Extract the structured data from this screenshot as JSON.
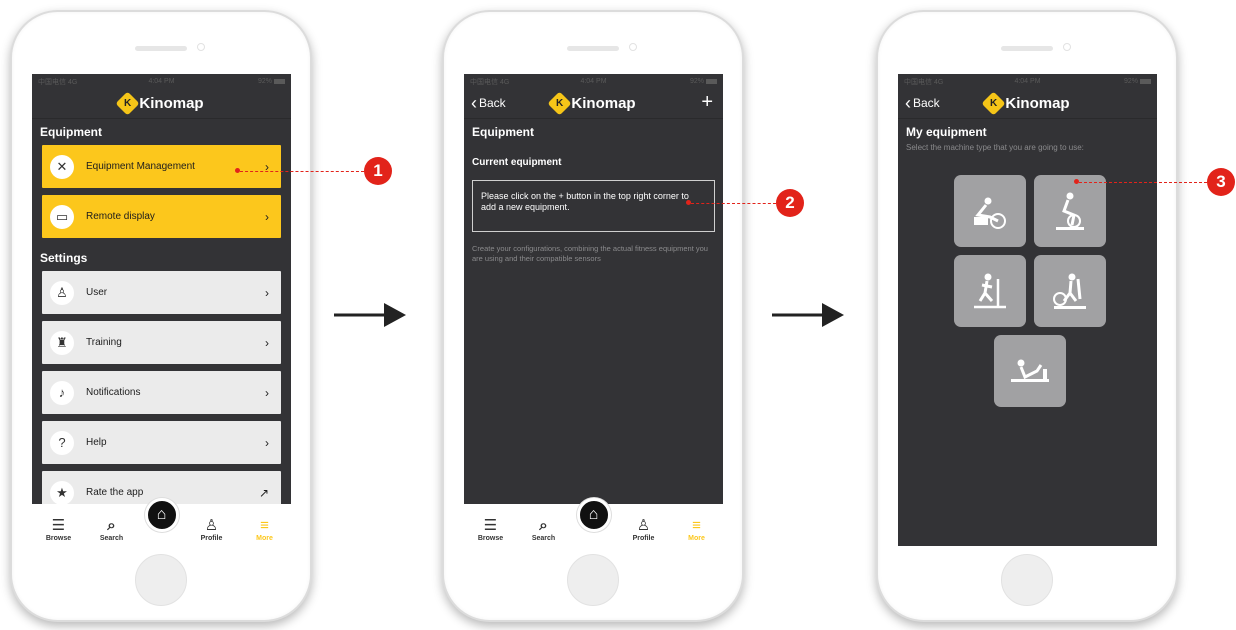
{
  "brand": "Kinomap",
  "status": {
    "carrier": "中国电信 4G",
    "time": "4:04 PM",
    "battery": "92%"
  },
  "screen1": {
    "section_equipment": "Equipment",
    "equipment_items": [
      {
        "label": "Equipment Management",
        "icon": "tools-icon"
      },
      {
        "label": "Remote display",
        "icon": "monitor-icon"
      }
    ],
    "section_settings": "Settings",
    "settings_items": [
      {
        "label": "User",
        "icon": "user-icon"
      },
      {
        "label": "Training",
        "icon": "trophy-icon"
      },
      {
        "label": "Notifications",
        "icon": "bell-icon"
      },
      {
        "label": "Help",
        "icon": "help-icon"
      },
      {
        "label": "Rate the app",
        "icon": "star-hand-icon"
      }
    ]
  },
  "screen2": {
    "back": "Back",
    "title": "Equipment",
    "current_label": "Current equipment",
    "hint": "Please click on the + button in the top right corner to add a new equipment.",
    "description": "Create your configurations, combining the actual fitness equipment you are using and their compatible sensors"
  },
  "screen3": {
    "back": "Back",
    "title": "My equipment",
    "subtitle": "Select the machine type that you are going to use:",
    "machines": [
      "bike-icon",
      "spin-bike-icon",
      "treadmill-icon",
      "elliptical-icon",
      "rower-icon"
    ]
  },
  "tabs": [
    {
      "label": "Browse",
      "icon": "browse-icon"
    },
    {
      "label": "Search",
      "icon": "search-icon"
    },
    {
      "label": "",
      "icon": "home-icon"
    },
    {
      "label": "Profile",
      "icon": "profile-icon"
    },
    {
      "label": "More",
      "icon": "menu-icon"
    }
  ],
  "callouts": [
    "1",
    "2",
    "3"
  ],
  "colors": {
    "accent": "#fcc71c",
    "screen_bg": "#333336",
    "callout": "#e2231a",
    "tile": "#a1a1a3"
  }
}
